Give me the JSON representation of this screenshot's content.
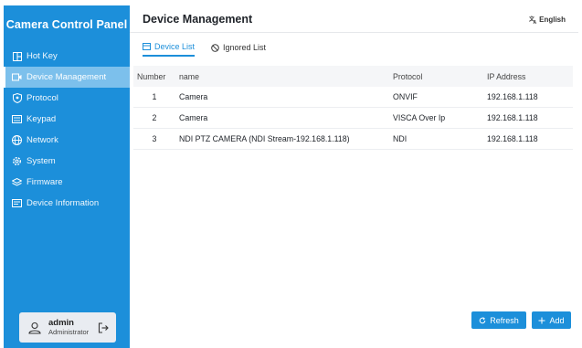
{
  "sidebar": {
    "title": "Camera Control Panel",
    "items": [
      {
        "label": "Hot Key",
        "icon": "hotkey-icon",
        "active": false
      },
      {
        "label": "Device Management",
        "icon": "camera-icon",
        "active": true
      },
      {
        "label": "Protocol",
        "icon": "shield-icon",
        "active": false
      },
      {
        "label": "Keypad",
        "icon": "keyboard-icon",
        "active": false
      },
      {
        "label": "Network",
        "icon": "globe-icon",
        "active": false
      },
      {
        "label": "System",
        "icon": "gear-icon",
        "active": false
      },
      {
        "label": "Firmware",
        "icon": "layers-icon",
        "active": false
      },
      {
        "label": "Device Information",
        "icon": "info-card-icon",
        "active": false
      }
    ],
    "user": {
      "name": "admin",
      "role": "Administrator"
    }
  },
  "header": {
    "title": "Device Management",
    "language": "English"
  },
  "tabs": [
    {
      "label": "Device List",
      "active": true
    },
    {
      "label": "Ignored List",
      "active": false
    }
  ],
  "table": {
    "columns": [
      "Number",
      "name",
      "Protocol",
      "IP Address"
    ],
    "rows": [
      {
        "number": "1",
        "name": "Camera",
        "protocol": "ONVIF",
        "ip": "192.168.1.118"
      },
      {
        "number": "2",
        "name": "Camera",
        "protocol": "VISCA Over Ip",
        "ip": "192.168.1.118"
      },
      {
        "number": "3",
        "name": "NDI PTZ CAMERA (NDI Stream-192.168.1.118)",
        "protocol": "NDI",
        "ip": "192.168.1.118"
      }
    ]
  },
  "actions": {
    "refresh_label": "Refresh",
    "add_label": "Add"
  },
  "colors": {
    "accent": "#1c8fda",
    "active_nav": "#7cc0ec"
  }
}
